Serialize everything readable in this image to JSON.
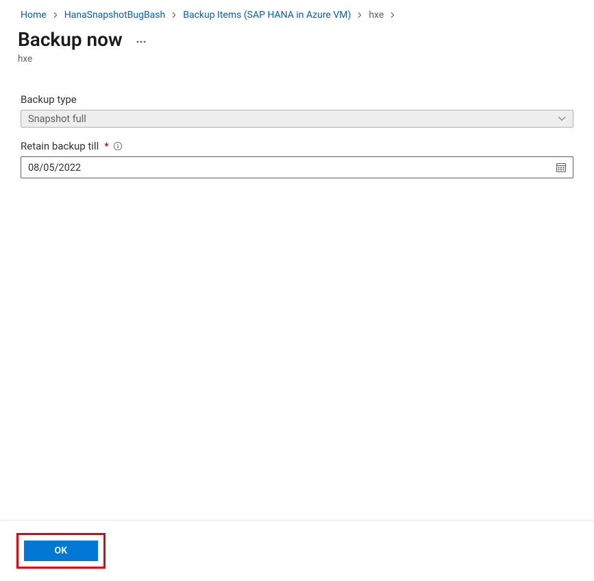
{
  "breadcrumb": {
    "items": [
      {
        "label": "Home"
      },
      {
        "label": "HanaSnapshotBugBash"
      },
      {
        "label": "Backup Items (SAP HANA in Azure VM)"
      },
      {
        "label": "hxe"
      }
    ]
  },
  "header": {
    "title": "Backup now",
    "subtitle": "hxe"
  },
  "form": {
    "backupType": {
      "label": "Backup type",
      "value": "Snapshot full"
    },
    "retain": {
      "label": "Retain backup till",
      "value": "08/05/2022"
    }
  },
  "footer": {
    "ok_label": "OK"
  }
}
